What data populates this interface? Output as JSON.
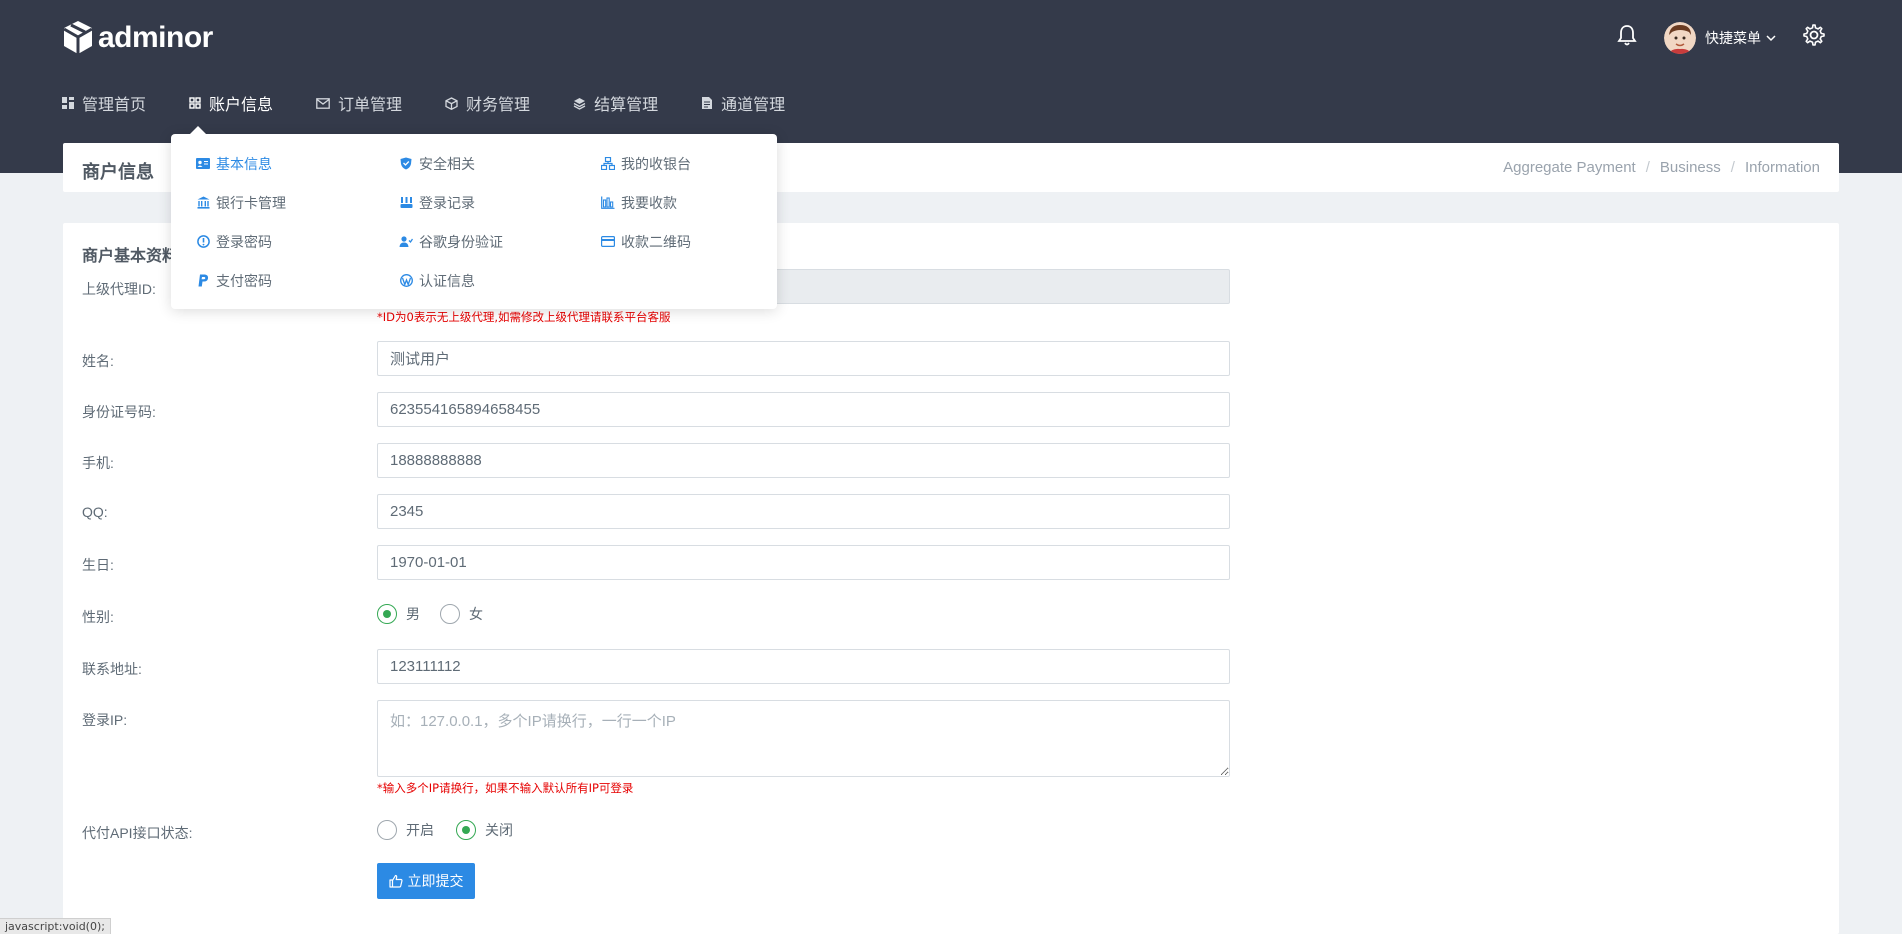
{
  "app": {
    "logo_text": "adminor"
  },
  "header": {
    "user_name": "快捷菜单"
  },
  "nav": [
    {
      "label": "管理首页",
      "icon": "dashboard-icon"
    },
    {
      "label": "账户信息",
      "icon": "account-icon",
      "active": true
    },
    {
      "label": "订单管理",
      "icon": "mail-icon"
    },
    {
      "label": "财务管理",
      "icon": "cube-icon"
    },
    {
      "label": "结算管理",
      "icon": "layers-icon"
    },
    {
      "label": "通道管理",
      "icon": "document-icon"
    }
  ],
  "dropdown": {
    "col1": [
      {
        "label": "基本信息",
        "icon": "id-card-icon",
        "active": true
      },
      {
        "label": "银行卡管理",
        "icon": "bank-icon"
      },
      {
        "label": "登录密码",
        "icon": "info-circle-icon"
      },
      {
        "label": "支付密码",
        "icon": "paypal-icon"
      }
    ],
    "col2": [
      {
        "label": "安全相关",
        "icon": "shield-icon"
      },
      {
        "label": "登录记录",
        "icon": "records-icon"
      },
      {
        "label": "谷歌身份验证",
        "icon": "user-check-icon"
      },
      {
        "label": "认证信息",
        "icon": "wordpress-icon"
      }
    ],
    "col3": [
      {
        "label": "我的收银台",
        "icon": "sitemap-icon"
      },
      {
        "label": "我要收款",
        "icon": "chart-icon"
      },
      {
        "label": "收款二维码",
        "icon": "credit-card-icon"
      }
    ]
  },
  "page": {
    "title": "商户信息",
    "breadcrumb": [
      "Aggregate Payment",
      "Business",
      "Information"
    ]
  },
  "form": {
    "section_title": "商户基本资料",
    "parent_id_label": "上级代理ID:",
    "parent_id_value": "",
    "parent_id_hint": "*ID为0表示无上级代理,如需修改上级代理请联系平台客服",
    "name_label": "姓名:",
    "name_value": "测试用户",
    "idcard_label": "身份证号码:",
    "idcard_value": "623554165894658455",
    "phone_label": "手机:",
    "phone_value": "18888888888",
    "qq_label": "QQ:",
    "qq_value": "2345",
    "birthday_label": "生日:",
    "birthday_value": "1970-01-01",
    "gender_label": "性别:",
    "gender_options": [
      "男",
      "女"
    ],
    "gender_selected": "男",
    "address_label": "联系地址:",
    "address_value": "123111112",
    "login_ip_label": "登录IP:",
    "login_ip_placeholder": "如：127.0.0.1，多个IP请换行，一行一个IP",
    "login_ip_hint": "*输入多个IP请换行，如果不输入默认所有IP可登录",
    "api_status_label": "代付API接口状态:",
    "api_status_options": [
      "开启",
      "关闭"
    ],
    "api_status_selected": "关闭",
    "submit_label": "立即提交"
  },
  "statusbar": {
    "text": "javascript:void(0);"
  },
  "colors": {
    "topbar": "#343a4a",
    "accent": "#2c8ae4",
    "radio_checked": "#34a853",
    "hint": "#e60000"
  }
}
